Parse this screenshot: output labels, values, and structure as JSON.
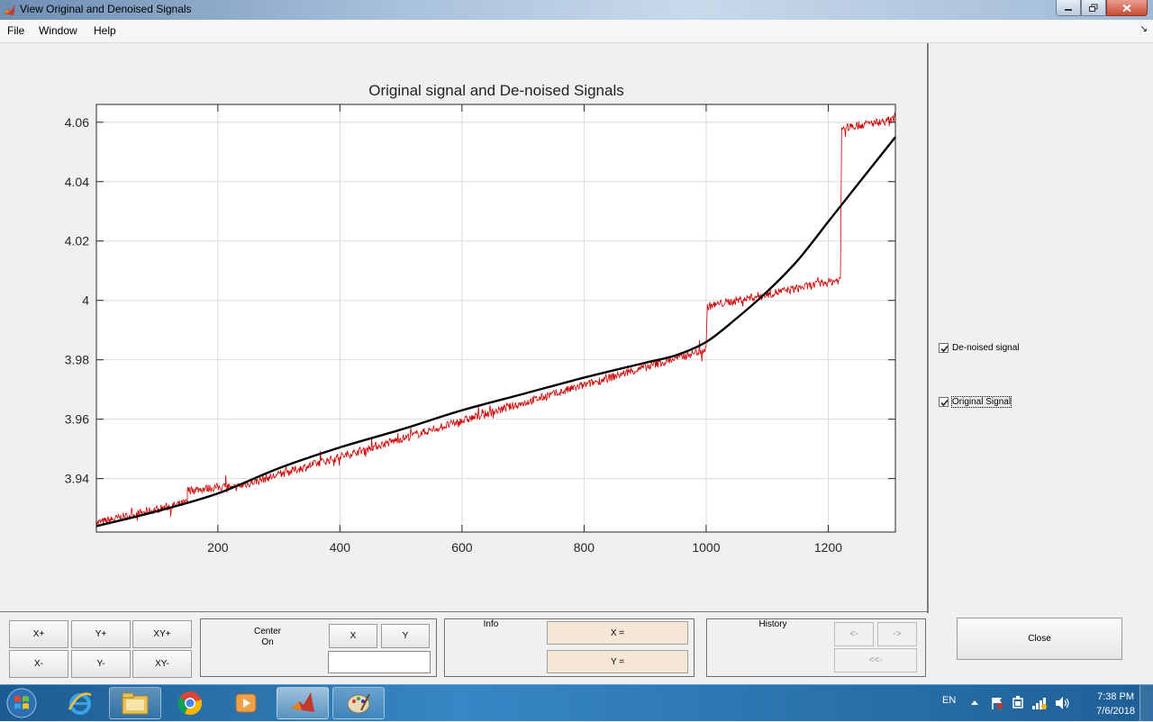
{
  "window": {
    "title": "View Original and Denoised Signals",
    "menu": [
      "File",
      "Window",
      "Help"
    ],
    "dock_glyph": "↘"
  },
  "chart_data": {
    "type": "line",
    "title": "Original signal and De-noised Signals",
    "xlabel": "",
    "ylabel": "",
    "xlim": [
      1,
      1310
    ],
    "ylim": [
      3.922,
      4.066
    ],
    "xticks": [
      200,
      400,
      600,
      800,
      1000,
      1200
    ],
    "yticks": [
      3.94,
      3.96,
      3.98,
      4,
      4.02,
      4.04,
      4.06
    ],
    "ytick_labels": [
      "3.94",
      "3.96",
      "3.98",
      "4",
      "4.02",
      "4.04",
      "4.06"
    ],
    "grid": true,
    "series": [
      {
        "color": "#cc0000",
        "noisy": true,
        "segments": [
          {
            "x": [
              1,
              150
            ],
            "y": [
              3.925,
              3.932
            ]
          },
          {
            "x": [
              150,
              220
            ],
            "y": [
              3.936,
              3.9375
            ]
          },
          {
            "x": [
              220,
              1000
            ],
            "y": [
              3.9365,
              3.9835
            ]
          },
          {
            "x": [
              1002,
              1220
            ],
            "y": [
              3.998,
              4.007
            ]
          },
          {
            "x": [
              1222,
              1310
            ],
            "y": [
              4.058,
              4.061
            ]
          }
        ]
      },
      {
        "color": "#000000",
        "noisy": false,
        "x": [
          1,
          100,
          200,
          300,
          400,
          500,
          600,
          700,
          800,
          900,
          950,
          1000,
          1050,
          1100,
          1150,
          1200,
          1250,
          1310
        ],
        "y": [
          3.924,
          3.929,
          3.935,
          3.9435,
          3.9505,
          3.9565,
          3.963,
          3.9685,
          3.974,
          3.979,
          3.9815,
          3.986,
          3.994,
          4.003,
          4.0135,
          4.0265,
          4.0395,
          4.055
        ]
      }
    ]
  },
  "checkboxes": [
    {
      "label": "De-noised signal",
      "checked": true
    },
    {
      "label": "Original Signal",
      "checked": true
    }
  ],
  "zoom_buttons": {
    "x_plus": "X+",
    "y_plus": "Y+",
    "xy_plus": "XY+",
    "x_minus": "X-",
    "y_minus": "Y-",
    "xy_minus": "XY-"
  },
  "center": {
    "label_line1": "Center",
    "label_line2": "On",
    "x_button": "X",
    "y_button": "Y",
    "value": ""
  },
  "info": {
    "title": "Info",
    "x_label": "X =",
    "y_label": "Y ="
  },
  "history": {
    "title": "History",
    "back": "<-",
    "forward": "->",
    "first": "<<-"
  },
  "close_button": "Close",
  "taskbar": {
    "language": "EN",
    "time": "7:38 PM",
    "date": "7/6/2018"
  }
}
